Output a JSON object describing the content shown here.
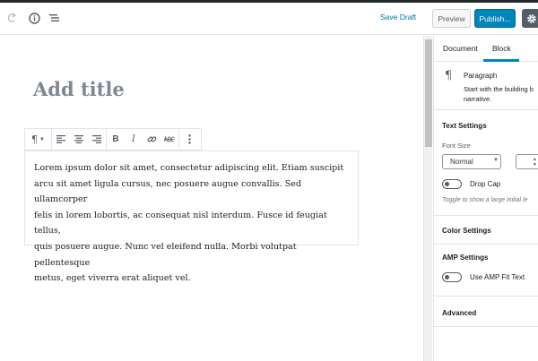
{
  "header": {
    "save_draft": "Save Draft",
    "preview": "Preview",
    "publish": "Publish...",
    "icons": [
      "redo-icon",
      "info-icon",
      "outline-icon",
      "gear-icon"
    ]
  },
  "editor": {
    "title_placeholder": "Add title",
    "toolbar": [
      "paragraph-icon",
      "align-left-icon",
      "align-center-icon",
      "align-right-icon",
      "bold-icon",
      "italic-icon",
      "link-icon",
      "strikethrough-icon",
      "more-options-icon"
    ],
    "paragraph_lines": [
      "Lorem ipsum dolor sit amet, consectetur adipiscing elit. Etiam suscipit",
      "arcu sit amet ligula cursus, nec posuere augue convallis. Sed  ullamcorper",
      "felis in lorem lobortis, ac consequat nisl interdum. Fusce  id feugiat tellus,",
      "quis posuere augue. Nunc vel eleifend nulla. Morbi  volutpat pellentesque",
      "metus, eget viverra erat aliquet vel."
    ]
  },
  "sidebar": {
    "tabs": [
      "Document",
      "Block"
    ],
    "active_tab": "Block",
    "block": {
      "name": "Paragraph",
      "description_lines": [
        "Start with the building b",
        "narrative."
      ]
    },
    "text_settings": {
      "title": "Text Settings",
      "font_size_label": "Font Size",
      "font_size_value": "Normal",
      "drop_cap_label": "Drop Cap",
      "drop_cap_help": "Toggle to show a large initial le"
    },
    "color_settings": {
      "title": "Color Settings"
    },
    "amp_settings": {
      "title": "AMP Settings",
      "fit_text_label": "Use AMP Fit Text"
    },
    "advanced": {
      "title": "Advanced"
    }
  },
  "colors": {
    "accent": "#0085ba",
    "link": "#0073aa",
    "dark": "#23282d"
  }
}
